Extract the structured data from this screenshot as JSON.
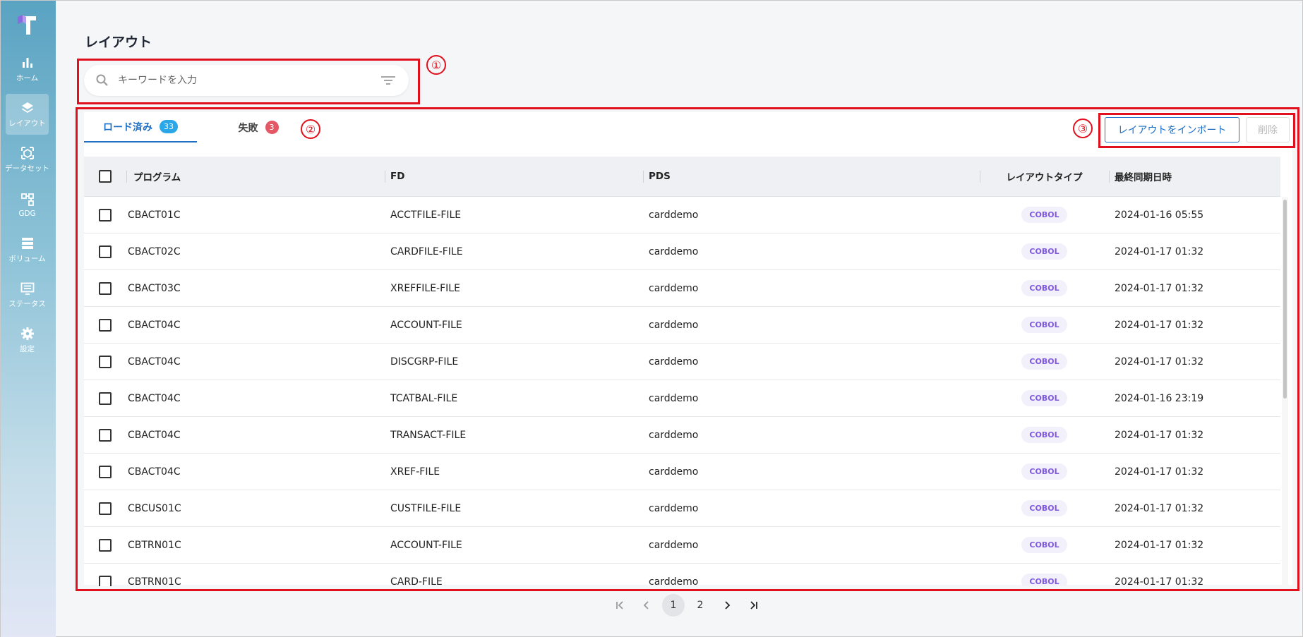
{
  "sidebar": {
    "items": [
      {
        "label": "ホーム",
        "icon": "bar-chart-icon"
      },
      {
        "label": "レイアウト",
        "icon": "layers-icon",
        "active": true
      },
      {
        "label": "データセット",
        "icon": "dataset-icon"
      },
      {
        "label": "GDG",
        "icon": "gdg-icon"
      },
      {
        "label": "ボリューム",
        "icon": "volume-icon"
      },
      {
        "label": "ステータス",
        "icon": "status-icon"
      },
      {
        "label": "設定",
        "icon": "gear-icon"
      }
    ]
  },
  "page": {
    "title": "レイアウト"
  },
  "search": {
    "placeholder": "キーワードを入力"
  },
  "tabs": [
    {
      "label": "ロード済み",
      "count": "33"
    },
    {
      "label": "失敗",
      "count": "3"
    }
  ],
  "actions": {
    "import_label": "レイアウトをインポート",
    "delete_label": "削除"
  },
  "table": {
    "headers": {
      "program": "プログラム",
      "fd": "FD",
      "pds": "PDS",
      "layout_type": "レイアウトタイプ",
      "last_sync": "最終同期日時"
    },
    "rows": [
      {
        "program": "CBACT01C",
        "fd": "ACCTFILE-FILE",
        "pds": "carddemo",
        "type": "COBOL",
        "date": "2024-01-16 05:55"
      },
      {
        "program": "CBACT02C",
        "fd": "CARDFILE-FILE",
        "pds": "carddemo",
        "type": "COBOL",
        "date": "2024-01-17 01:32"
      },
      {
        "program": "CBACT03C",
        "fd": "XREFFILE-FILE",
        "pds": "carddemo",
        "type": "COBOL",
        "date": "2024-01-17 01:32"
      },
      {
        "program": "CBACT04C",
        "fd": "ACCOUNT-FILE",
        "pds": "carddemo",
        "type": "COBOL",
        "date": "2024-01-17 01:32"
      },
      {
        "program": "CBACT04C",
        "fd": "DISCGRP-FILE",
        "pds": "carddemo",
        "type": "COBOL",
        "date": "2024-01-17 01:32"
      },
      {
        "program": "CBACT04C",
        "fd": "TCATBAL-FILE",
        "pds": "carddemo",
        "type": "COBOL",
        "date": "2024-01-16 23:19"
      },
      {
        "program": "CBACT04C",
        "fd": "TRANSACT-FILE",
        "pds": "carddemo",
        "type": "COBOL",
        "date": "2024-01-17 01:32"
      },
      {
        "program": "CBACT04C",
        "fd": "XREF-FILE",
        "pds": "carddemo",
        "type": "COBOL",
        "date": "2024-01-17 01:32"
      },
      {
        "program": "CBCUS01C",
        "fd": "CUSTFILE-FILE",
        "pds": "carddemo",
        "type": "COBOL",
        "date": "2024-01-17 01:32"
      },
      {
        "program": "CBTRN01C",
        "fd": "ACCOUNT-FILE",
        "pds": "carddemo",
        "type": "COBOL",
        "date": "2024-01-17 01:32"
      },
      {
        "program": "CBTRN01C",
        "fd": "CARD-FILE",
        "pds": "carddemo",
        "type": "COBOL",
        "date": "2024-01-17 01:32"
      }
    ]
  },
  "pagination": {
    "pages": [
      "1",
      "2"
    ],
    "current": "1"
  },
  "annotations": [
    "①",
    "②",
    "③"
  ],
  "colors": {
    "accent": "#1f6fc4",
    "annotation": "#e0101c",
    "cobol_tag": "#7f59e1"
  }
}
